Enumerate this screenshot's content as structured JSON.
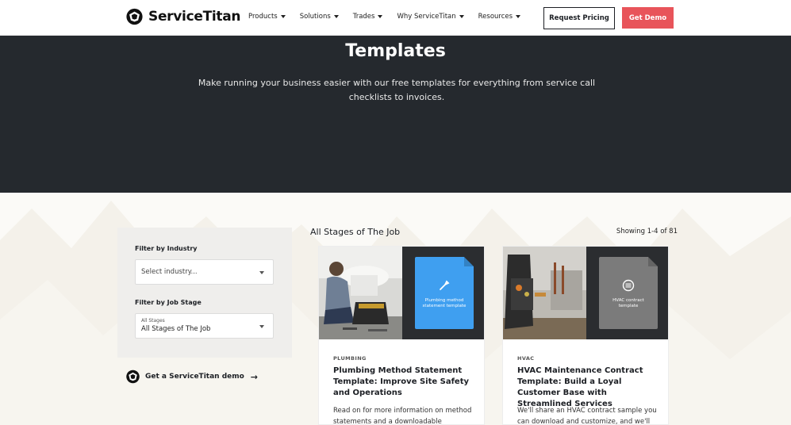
{
  "header": {
    "logo_text": "ServiceTitan",
    "nav": [
      {
        "label": "Products"
      },
      {
        "label": "Solutions"
      },
      {
        "label": "Trades"
      },
      {
        "label": "Why ServiceTitan"
      },
      {
        "label": "Resources"
      }
    ],
    "request_pricing": "Request Pricing",
    "get_demo": "Get Demo"
  },
  "hero": {
    "title": "Templates",
    "subtitle": "Make running your business easier with our free templates for everything from service call checklists to invoices."
  },
  "sidebar": {
    "industry_label": "Filter by Industry",
    "industry_placeholder": "Select industry...",
    "stage_label": "Filter by Job Stage",
    "stage_small": "All Stages",
    "stage_value": "All Stages of The Job",
    "demo_link": "Get a ServiceTitan demo"
  },
  "results": {
    "title": "All Stages of The Job",
    "count": "Showing 1-4 of 81"
  },
  "cards": [
    {
      "doc_label": "Plumbing method statement template",
      "tag": "PLUMBING",
      "title": "Plumbing Method Statement Template: Improve Site Safety and Operations",
      "desc": "Read on for more information on method statements and a downloadable",
      "doc_color": "#3f9ff0"
    },
    {
      "doc_label": "HVAC contract template",
      "tag": "HVAC",
      "title": "HVAC Maintenance Contract Template: Build a Loyal Customer Base with Streamlined Services",
      "desc": "We'll share an HVAC contract sample you can download and customize, and we'll",
      "doc_color": "#7b7b7b"
    }
  ],
  "colors": {
    "accent": "#e8545a",
    "hero_bg": "#25292e"
  }
}
